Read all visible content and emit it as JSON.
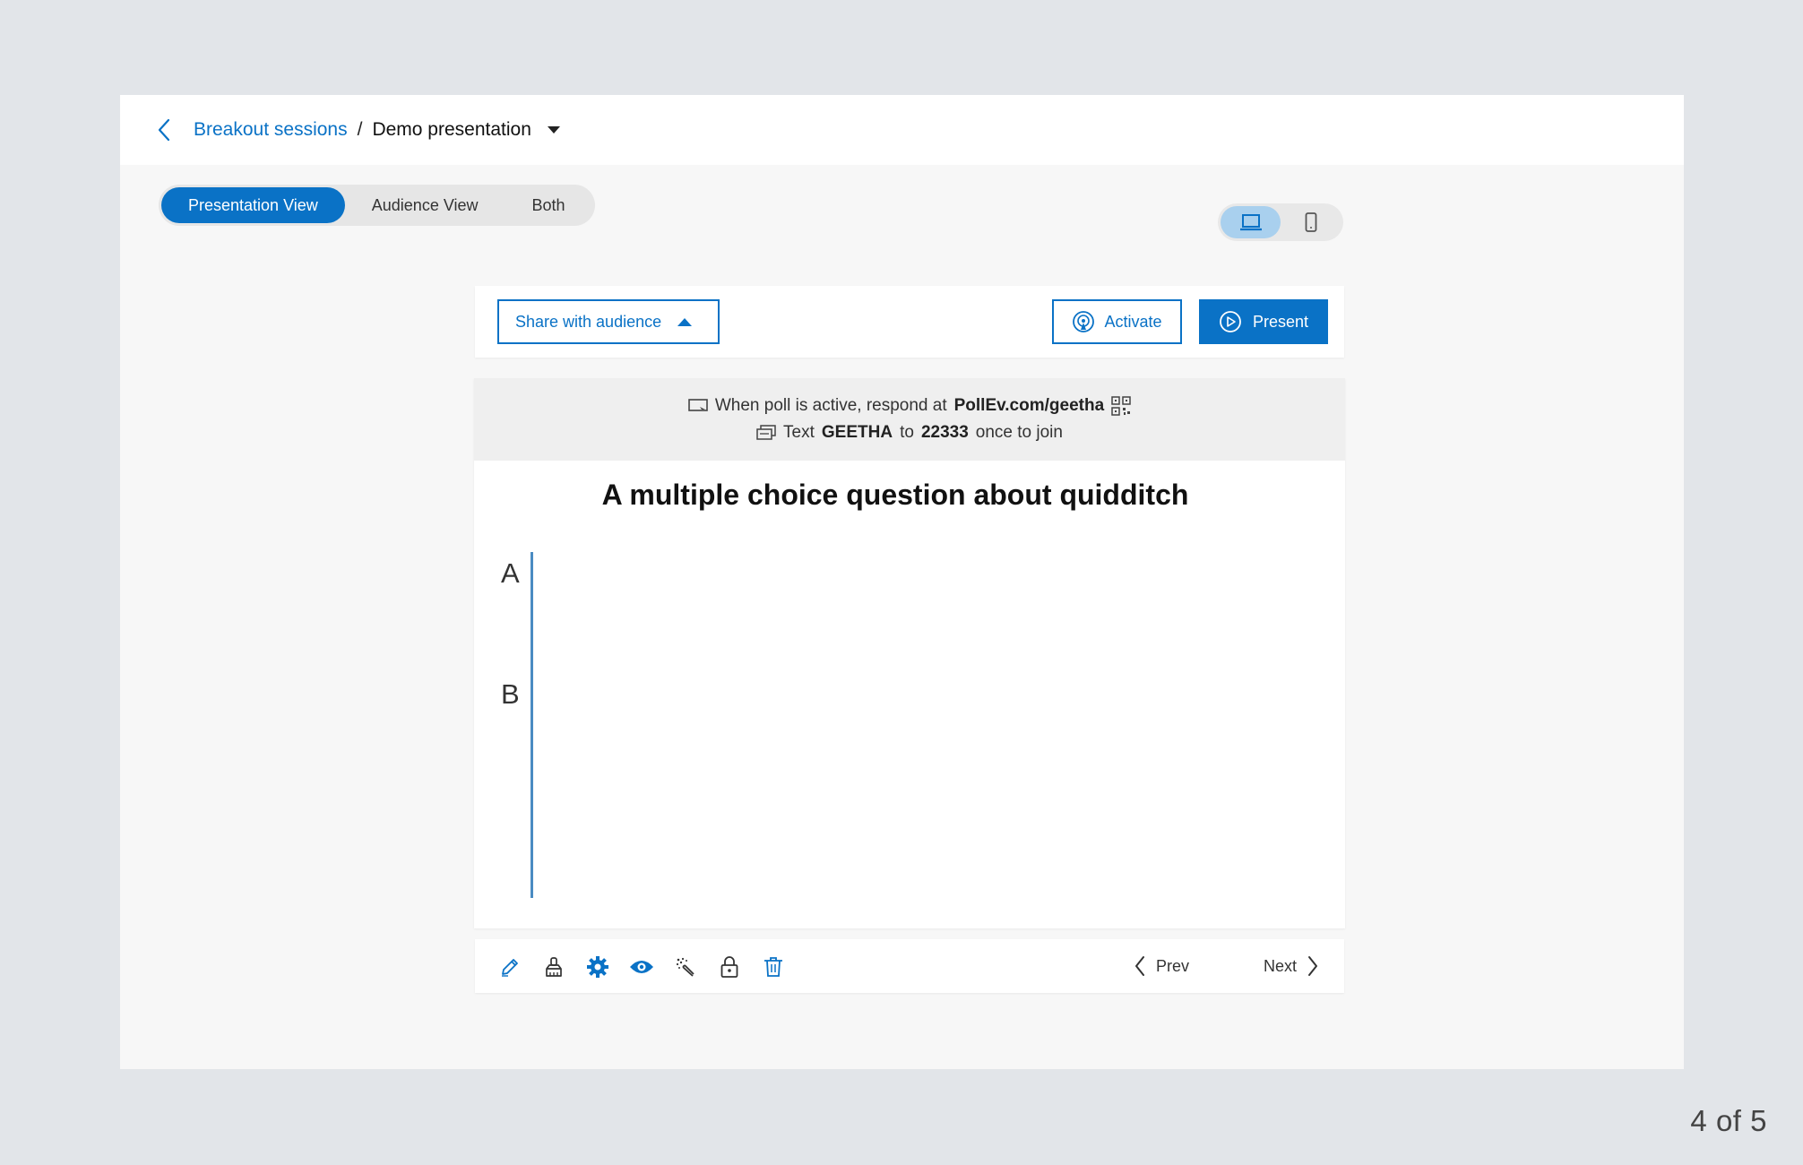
{
  "breadcrumb": {
    "parent": "Breakout sessions",
    "separator": "/",
    "current": "Demo presentation"
  },
  "view_toggle": {
    "items": [
      {
        "label": "Presentation View",
        "active": true
      },
      {
        "label": "Audience View",
        "active": false
      },
      {
        "label": "Both",
        "active": false
      }
    ]
  },
  "device_toggle": {
    "options": [
      "laptop-icon",
      "mobile-icon"
    ],
    "selected": "laptop-icon"
  },
  "toolbar": {
    "share_label": "Share with audience",
    "activate_label": "Activate",
    "present_label": "Present"
  },
  "banner": {
    "line1_prefix": "When poll is active, respond at",
    "line1_url": "PollEv.com/geetha",
    "line2_prefix": "Text",
    "line2_code": "GEETHA",
    "line2_mid": "to",
    "line2_number": "22333",
    "line2_suffix": "once to join"
  },
  "slide": {
    "title": "A multiple choice question about quidditch"
  },
  "chart_data": {
    "type": "bar",
    "orientation": "horizontal",
    "categories": [
      "A",
      "B"
    ],
    "values": [
      0,
      0
    ]
  },
  "bottom_tools": [
    "pencil-icon",
    "paint-brush-icon",
    "gear-icon",
    "eye-icon",
    "clear-responses-icon",
    "lock-icon",
    "trash-icon"
  ],
  "navigation": {
    "prev_label": "Prev",
    "next_label": "Next"
  },
  "page_counter": "4 of 5",
  "colors": {
    "accent": "#0a72c6",
    "accent_light": "#a9d0ee",
    "background": "#e2e5e9"
  }
}
